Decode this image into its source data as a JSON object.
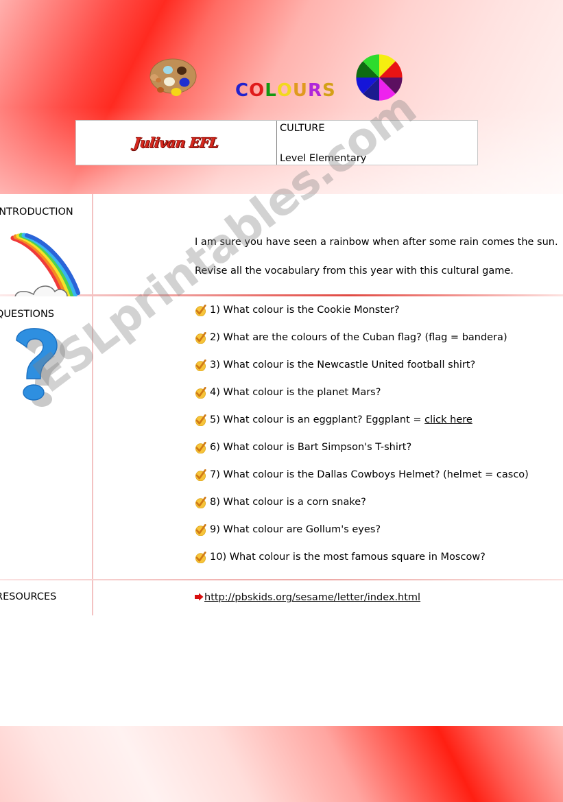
{
  "title_word": {
    "letters": [
      {
        "char": "C",
        "color": "#2222cc"
      },
      {
        "char": "O",
        "color": "#e01b1b"
      },
      {
        "char": "L",
        "color": "#119911"
      },
      {
        "char": "O",
        "color": "#f2d81e"
      },
      {
        "char": "U",
        "color": "#e09a1e"
      },
      {
        "char": "R",
        "color": "#b026d9"
      },
      {
        "char": "S",
        "color": "#d4a017"
      }
    ],
    "text": "COLOURS"
  },
  "icons": {
    "palette": "paint-palette-icon",
    "color_wheel": "color-wheel-icon",
    "rainbow": "rainbow-cloud-icon",
    "question_mark": "question-mark-icon",
    "check": "check-mark-icon",
    "arrow": "red-arrow-icon"
  },
  "color_wheel_segments": [
    "#f5ee10",
    "#e81414",
    "#5c1060",
    "#ee22ee",
    "#1b1b8f",
    "#1515d8",
    "#0e6b11",
    "#2ddb2d"
  ],
  "header": {
    "logo": "Julivan EFL",
    "category": "CULTURE",
    "level": "Level Elementary"
  },
  "sections": {
    "introduction": {
      "label": "INTRODUCTION",
      "paragraphs": [
        "I am sure you have seen a rainbow when after some rain comes the sun.",
        "Revise all the vocabulary from this year with this cultural game."
      ]
    },
    "questions": {
      "label": "QUESTIONS",
      "items": [
        {
          "text": "1) What colour is the Cookie Monster?",
          "link": ""
        },
        {
          "text": "2) What are the colours of the Cuban flag? (flag = bandera)",
          "link": ""
        },
        {
          "text": "3) What colour is the Newcastle United football shirt?",
          "link": ""
        },
        {
          "text": "4) What colour is the planet Mars?",
          "link": ""
        },
        {
          "text": "5) What colour is an eggplant? Eggplant = ",
          "link": "click here"
        },
        {
          "text": "6) What colour is Bart Simpson's T-shirt?",
          "link": ""
        },
        {
          "text": "7) What colour is the Dallas Cowboys Helmet? (helmet = casco)",
          "link": ""
        },
        {
          "text": "8) What colour is a corn snake?",
          "link": ""
        },
        {
          "text": "9) What colour are Gollum's eyes?",
          "link": ""
        },
        {
          "text": "10) What colour is the most famous square in Moscow?",
          "link": ""
        }
      ]
    },
    "resources": {
      "label": "RESOURCES",
      "url": "http://pbskids.org/sesame/letter/index.html"
    }
  },
  "watermark": "ESLprintables.com",
  "colors": {
    "background_red": "#ff2a20",
    "table_border": "#f3c2c2",
    "logo_red": "#d8281e",
    "question_blue": "#2e8fe0"
  }
}
